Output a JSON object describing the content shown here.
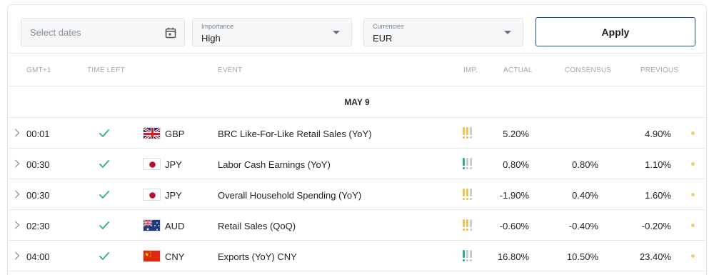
{
  "filters": {
    "dates_placeholder": "Select dates",
    "importance_label": "Importance",
    "importance_value": "High",
    "currencies_label": "Currencies",
    "currencies_value": "EUR",
    "apply_label": "Apply"
  },
  "columns": {
    "time": "GMT+1",
    "time_left": "TIME LEFT",
    "event": "EVENT",
    "importance": "IMP.",
    "actual": "ACTUAL",
    "consensus": "CONSENSUS",
    "previous": "PREVIOUS"
  },
  "date_header": "MAY 9",
  "colors": {
    "importance_high": "#f3c255",
    "importance_medium": "#2bab8f",
    "importance_inactive": "#c6ccd1",
    "check": "#2bab8f",
    "apply_border": "#1f4f82"
  },
  "rows": [
    {
      "time": "00:01",
      "status": "check-icon",
      "flag": "uk-flag-icon",
      "currency": "GBP",
      "event": "BRC Like-For-Like Retail Sales (YoY)",
      "importance": "high",
      "actual": "5.20%",
      "consensus": "",
      "previous": "4.90%"
    },
    {
      "time": "00:30",
      "status": "check-icon",
      "flag": "japan-flag-icon",
      "currency": "JPY",
      "event": "Labor Cash Earnings (YoY)",
      "importance": "medium",
      "actual": "0.80%",
      "consensus": "0.80%",
      "previous": "1.10%"
    },
    {
      "time": "00:30",
      "status": "check-icon",
      "flag": "japan-flag-icon",
      "currency": "JPY",
      "event": "Overall Household Spending (YoY)",
      "importance": "high",
      "actual": "-1.90%",
      "consensus": "0.40%",
      "previous": "1.60%"
    },
    {
      "time": "02:30",
      "status": "check-icon",
      "flag": "australia-flag-icon",
      "currency": "AUD",
      "event": "Retail Sales (QoQ)",
      "importance": "high",
      "actual": "-0.60%",
      "consensus": "-0.40%",
      "previous": "-0.20%"
    },
    {
      "time": "04:00",
      "status": "check-icon",
      "flag": "china-flag-icon",
      "currency": "CNY",
      "event": "Exports (YoY) CNY",
      "importance": "medium",
      "actual": "16.80%",
      "consensus": "10.50%",
      "previous": "23.40%"
    }
  ]
}
